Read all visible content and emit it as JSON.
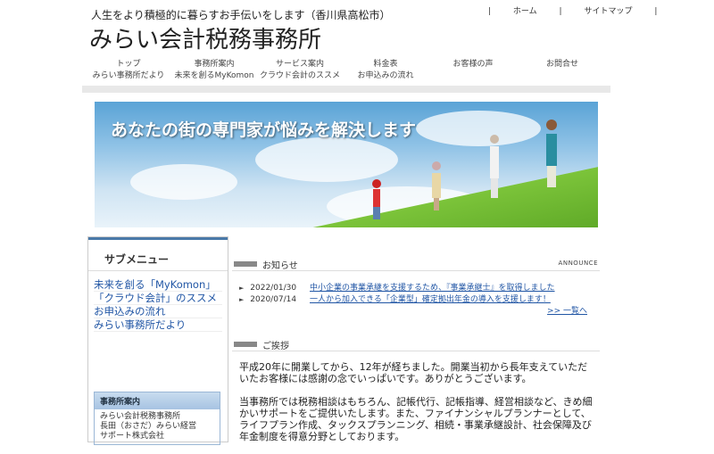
{
  "header": {
    "tagline": "人生をより積極的に暮らすお手伝いをします（香川県高松市）",
    "title": "みらい会計税務事務所",
    "toplinks": [
      "ホーム",
      "サイトマップ"
    ]
  },
  "nav": [
    {
      "label": "トップ",
      "sub": "みらい事務所だより"
    },
    {
      "label": "事務所案内",
      "sub": "未来を創るMyKomon"
    },
    {
      "label": "サービス案内",
      "sub": "クラウド会計のススメ"
    },
    {
      "label": "料金表",
      "sub": "お申込みの流れ"
    },
    {
      "label": "お客様の声",
      "sub": ""
    },
    {
      "label": "お問合せ",
      "sub": ""
    }
  ],
  "hero": {
    "headline": "あなたの街の専門家が悩みを解決します"
  },
  "sidebar": {
    "title": "サブメニュー",
    "links": [
      "未来を創る「MyKomon」",
      "「クラウド会計」のススメ",
      "お申込みの流れ",
      "みらい事務所だより"
    ],
    "office_box": {
      "title": "事務所案内",
      "lines": [
        "みらい会計税務事務所",
        "長田（おさだ）みらい経営",
        "サポート株式会社"
      ]
    }
  },
  "announce": {
    "title": "お知らせ",
    "en": "ANNOUNCE",
    "items": [
      {
        "date": "2022/01/30",
        "text": "中小企業の事業承継を支援するため、『事業承継士』を取得しました"
      },
      {
        "date": "2020/07/14",
        "text": "一人から加入できる「企業型」確定拠出年金の導入を支援します！"
      }
    ],
    "more": ">> 一覧へ"
  },
  "greeting": {
    "title": "ご挨拶",
    "paragraphs": [
      "平成20年に開業してから、12年が経ちました。開業当初から長年支えていただいたお客様には感謝の念でいっぱいです。ありがとうございます。",
      "当事務所では税務相談はもちろん、記帳代行、記帳指導、経営相談など、きめ細かいサポートをご提供いたします。また、ファイナンシャルプランナーとして、ライフプラン作成、タックスプランニング、相続・事業承継設計、社会保障及び年金制度を得意分野としております。"
    ]
  },
  "colors": {
    "accent": "#4a79a8",
    "link": "#2156a5",
    "grass": "#6fb92e"
  }
}
